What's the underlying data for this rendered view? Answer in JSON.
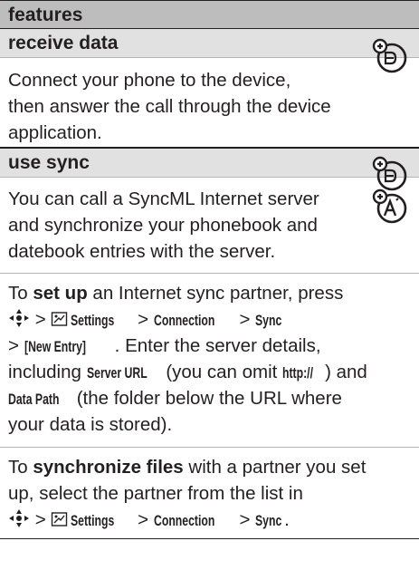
{
  "header": {
    "title": "features"
  },
  "features": [
    {
      "title": "receive data",
      "lines": [
        "Connect your phone to the device,",
        "then answer the call through the device",
        "application."
      ],
      "icons": [
        "data-call-icon"
      ]
    },
    {
      "title": "use sync",
      "intro_lines": [
        "You can call a SyncML Internet server",
        "and synchronize your phonebook and",
        "datebook entries with the server."
      ],
      "icons": [
        "data-call-icon",
        "sync-server-icon"
      ],
      "setup": {
        "to": "To",
        "bold": "set up",
        "rest1": " an Internet sync partner, press",
        "path1_sep": ">",
        "settings": "Settings",
        "connection": "Connection",
        "sync": "Sync",
        "new_entry": "[New Entry]",
        "line3_rest": ". Enter the server details,",
        "including": "including ",
        "server_url": "Server URL",
        "omit_pre": " (you can omit ",
        "http": "http://",
        "omit_post": ") and",
        "data_path": "Data Path",
        "data_path_rest": " (the folder below the URL where",
        "last": "your data is stored)."
      },
      "sync_files": {
        "to": "To ",
        "bold": "synchronize files",
        "rest1": " with a partner you set",
        "line2": "up, select the partner from the list in",
        "settings": "Settings",
        "connection": "Connection",
        "sync": "Sync",
        "end": "."
      }
    }
  ]
}
